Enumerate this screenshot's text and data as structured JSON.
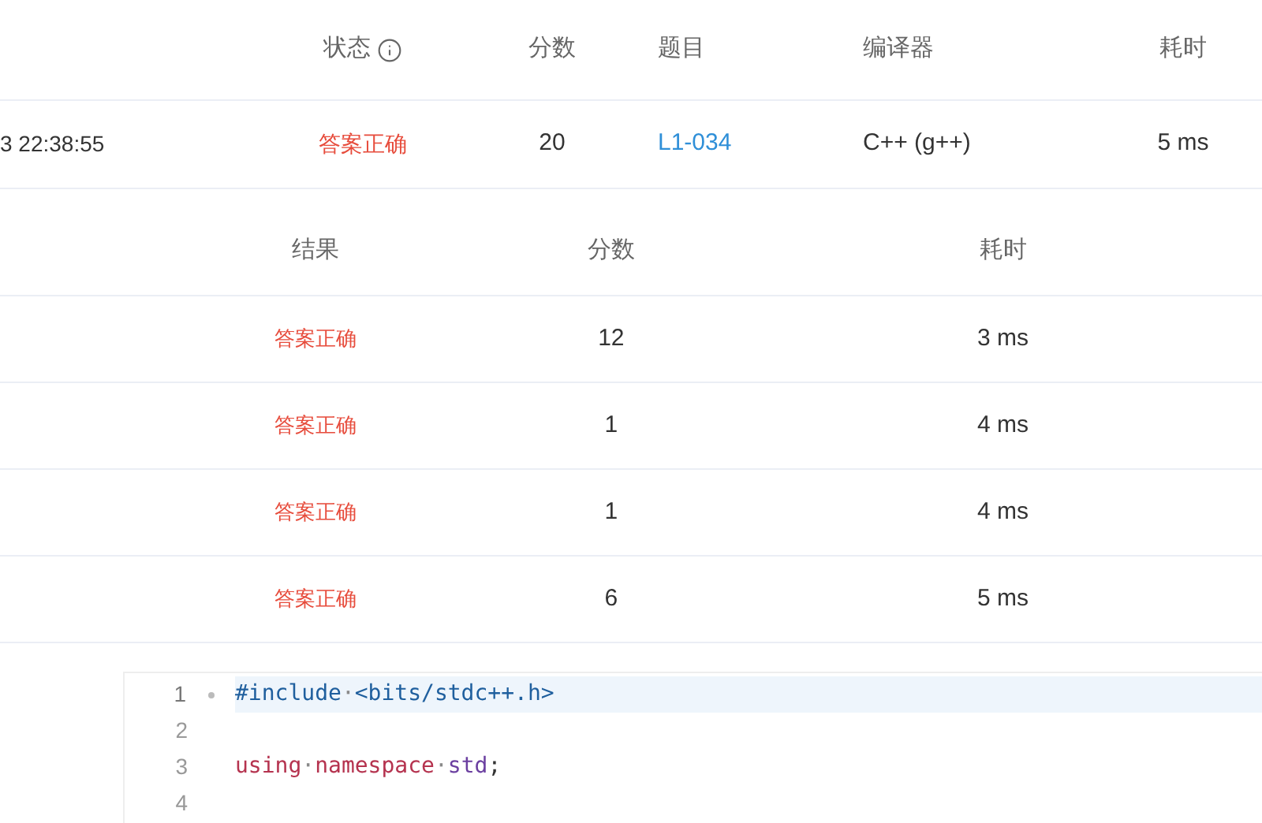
{
  "submission_table": {
    "columns": [
      {
        "label": "状态",
        "kind": "with_info"
      },
      {
        "label": "分数",
        "kind": "plain"
      },
      {
        "label": "题目",
        "kind": "plain"
      },
      {
        "label": "编译器",
        "kind": "plain"
      },
      {
        "label": "耗时",
        "kind": "plain"
      }
    ],
    "rows": [
      {
        "time": "3 22:38:55",
        "status": "答案正确",
        "score": "20",
        "problem": "L1-034",
        "compiler": "C++ (g++)",
        "duration": "5 ms"
      }
    ]
  },
  "test_cases": {
    "columns": [
      "结果",
      "分数",
      "耗时"
    ],
    "rows": [
      {
        "result": "答案正确",
        "score": "12",
        "duration": "3 ms"
      },
      {
        "result": "答案正确",
        "score": "1",
        "duration": "4 ms"
      },
      {
        "result": "答案正确",
        "score": "1",
        "duration": "4 ms"
      },
      {
        "result": "答案正确",
        "score": "6",
        "duration": "5 ms"
      }
    ]
  },
  "code_editor": {
    "lines": [
      {
        "number": "1",
        "active": true,
        "foldable": true,
        "tokens": [
          {
            "text": "#include",
            "kind": "directive"
          },
          {
            "text": "·",
            "kind": "space"
          },
          {
            "text": "<bits/stdc++.h>",
            "kind": "header"
          }
        ]
      },
      {
        "number": "2",
        "active": false,
        "foldable": false
      },
      {
        "number": "3",
        "active": false,
        "foldable": false,
        "tokens": [
          {
            "text": "using",
            "kind": "keyword"
          },
          {
            "text": "·",
            "kind": "space"
          },
          {
            "text": "namespace",
            "kind": "keyword"
          },
          {
            "text": "·",
            "kind": "space"
          },
          {
            "text": "std",
            "kind": "name"
          },
          {
            "text": ";",
            "kind": "punct"
          }
        ]
      },
      {
        "number": "4",
        "active": false,
        "foldable": false
      }
    ]
  }
}
